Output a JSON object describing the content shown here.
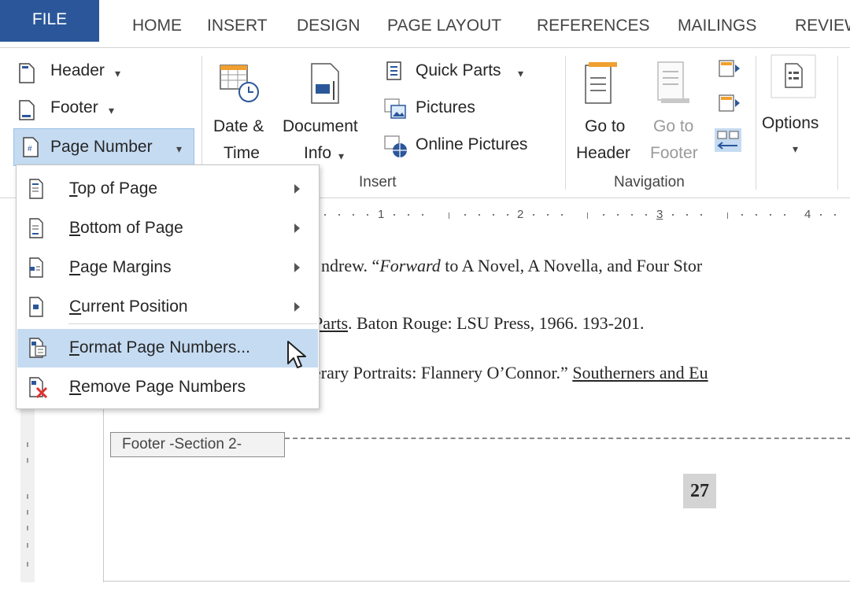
{
  "tabs": [
    "FILE",
    "HOME",
    "INSERT",
    "DESIGN",
    "PAGE LAYOUT",
    "REFERENCES",
    "MAILINGS",
    "REVIEW"
  ],
  "ribbon": {
    "header_footer": {
      "header": "Header",
      "footer": "Footer",
      "page_number": "Page Number"
    },
    "insert": {
      "date_time": [
        "Date &",
        "Time"
      ],
      "document_info": [
        "Document",
        "Info"
      ],
      "quick_parts": "Quick Parts",
      "pictures": "Pictures",
      "online_pictures": "Online Pictures",
      "group_label": "Insert"
    },
    "navigation": {
      "go_to_header": [
        "Go to",
        "Header"
      ],
      "go_to_footer": [
        "Go to",
        "Footer"
      ],
      "group_label": "Navigation"
    },
    "options": "Options"
  },
  "ruler_marks": [
    "1",
    "2",
    "3",
    "4"
  ],
  "page_number_menu": {
    "items": [
      {
        "accel": "T",
        "rest": "op of Page",
        "submenu": true
      },
      {
        "accel": "B",
        "rest": "ottom of Page",
        "submenu": true
      },
      {
        "accel": "P",
        "rest": "age Margins",
        "submenu": true
      },
      {
        "accel": "C",
        "rest": "urrent Position",
        "submenu": true
      },
      {
        "accel": "F",
        "rest": "ormat Page Numbers...",
        "submenu": false,
        "highlighted": true
      },
      {
        "accel": "R",
        "rest": "emove Page Numbers",
        "submenu": false
      }
    ]
  },
  "document": {
    "line1_pre": "ndrew. “",
    "line1_italic": "Forward",
    "line1_post": " to A Novel, A Novella, and Four Stor",
    "line2_underlined": "Parts",
    "line2_post": ". Baton Rouge: LSU Press, 1966. 193-201.",
    "line3_pre": "erary Portraits: Flannery O’Connor.” ",
    "line3_underlined": "Southerners and Eu",
    "footer_tag": "Footer -Section 2-",
    "page_number": "27"
  },
  "colors": {
    "file_tab": "#2b579a",
    "highlight": "#c5dbf2",
    "page_number_shading": "#d4d4d4"
  }
}
